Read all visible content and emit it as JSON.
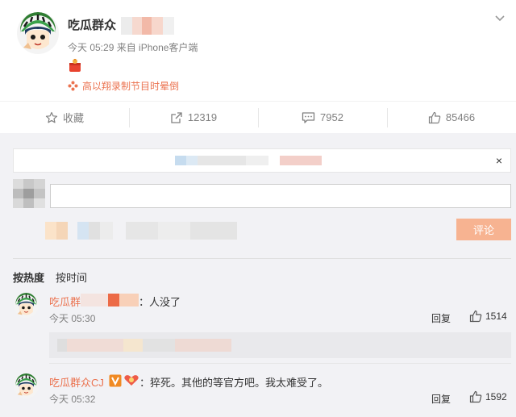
{
  "post": {
    "username": "吃瓜群众",
    "time": "今天 05:29",
    "source": "来自 iPhone客户端",
    "topic": "高以翔录制节目时晕倒",
    "icons": {
      "menu": "chevron-down-icon",
      "gift": "red-gift-icon",
      "topic": "topic-flower-icon"
    }
  },
  "actions": [
    {
      "label": "收藏",
      "icon": "star-icon"
    },
    {
      "label": "12319",
      "icon": "share-icon"
    },
    {
      "label": "7952",
      "icon": "comment-icon"
    },
    {
      "label": "85466",
      "icon": "like-icon"
    }
  ],
  "composer": {
    "submit_label": "评论",
    "close_glyph": "×",
    "submit_color": "#f7b391"
  },
  "sort": {
    "hot": "按热度",
    "time": "按时间"
  },
  "comments": [
    {
      "author": "吃瓜群",
      "text": "：人没了",
      "time": "今天 05:30",
      "reply": "回复",
      "likes": "1514"
    },
    {
      "author": "吃瓜群众CJ",
      "text": "：猝死。其他的等官方吧。我太难受了。",
      "time": "今天 05:32",
      "reply": "回复",
      "likes": "1592"
    }
  ],
  "colors": {
    "accent": "#eb7350",
    "background": "#f2f2f5",
    "muted_text": "#808080"
  }
}
